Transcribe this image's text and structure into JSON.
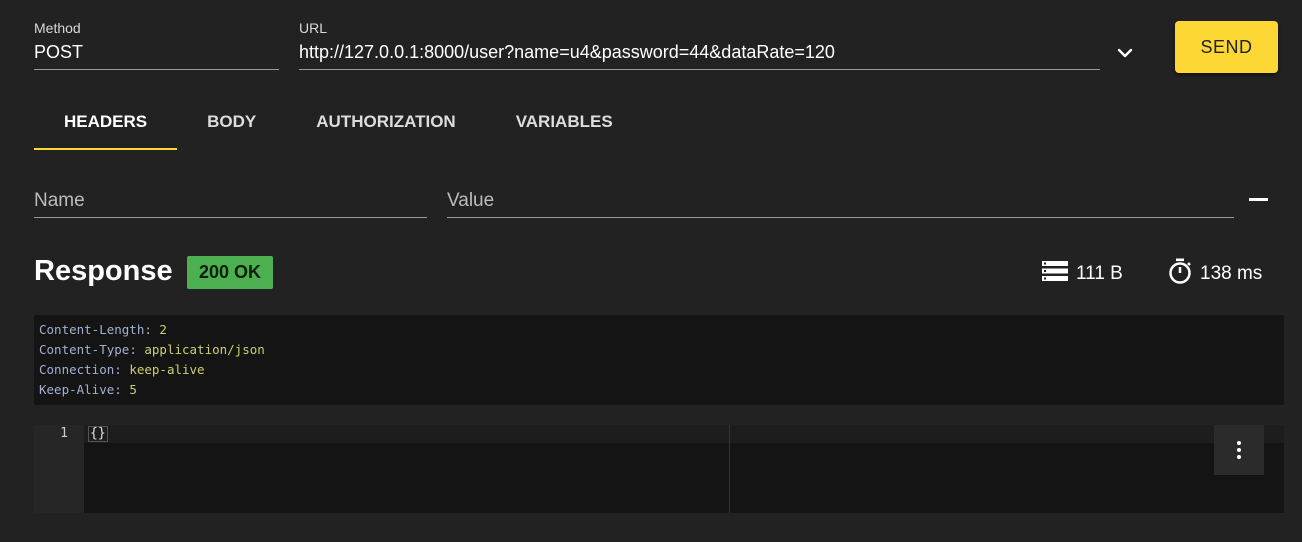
{
  "request": {
    "method_label": "Method",
    "method_value": "POST",
    "url_label": "URL",
    "url_value": "http://127.0.0.1:8000/user?name=u4&password=44&dataRate=120",
    "send_label": "SEND"
  },
  "tabs": [
    {
      "label": "HEADERS",
      "active": true
    },
    {
      "label": "BODY",
      "active": false
    },
    {
      "label": "AUTHORIZATION",
      "active": false
    },
    {
      "label": "VARIABLES",
      "active": false
    }
  ],
  "header_row": {
    "name_placeholder": "Name",
    "value_placeholder": "Value"
  },
  "response": {
    "title": "Response",
    "status": "200 OK",
    "size": "111 B",
    "time": "138 ms",
    "headers": [
      {
        "key": "Content-Length",
        "value": "2"
      },
      {
        "key": "Content-Type",
        "value": "application/json"
      },
      {
        "key": "Connection",
        "value": "keep-alive"
      },
      {
        "key": "Keep-Alive",
        "value": "5"
      }
    ],
    "body_line_number": "1",
    "body_text": "{}"
  },
  "colors": {
    "accent": "#fdd835",
    "status_ok": "#4caf50",
    "background": "#222222"
  },
  "icons": {
    "url_dropdown": "chevron-down-icon",
    "remove_header": "minus-icon",
    "size": "list-icon",
    "time": "stopwatch-icon",
    "more": "more-vertical-icon"
  }
}
